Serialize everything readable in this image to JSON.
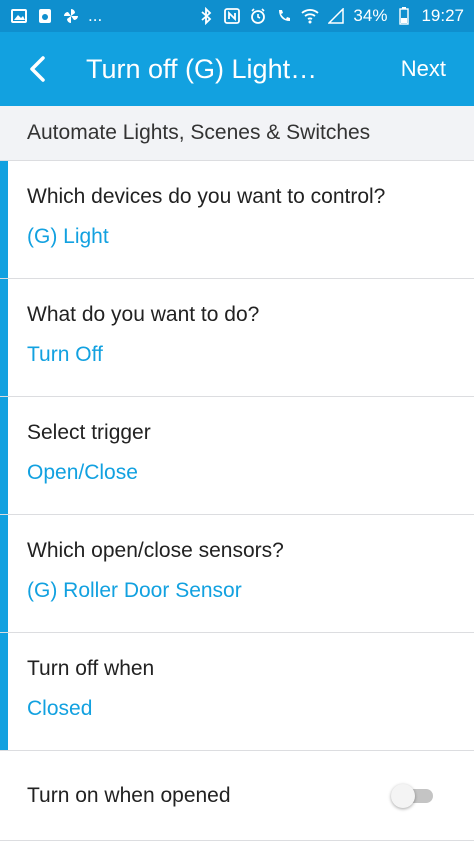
{
  "status_bar": {
    "left_icons": [
      "image-icon",
      "samsung-health-icon",
      "fan-icon"
    ],
    "more": "...",
    "right_icons": [
      "bluetooth-icon",
      "nfc-icon",
      "alarm-icon",
      "wifi-calling-icon",
      "wifi-icon",
      "signal-icon"
    ],
    "battery": "34%",
    "time": "19:27"
  },
  "app_bar": {
    "back_icon": "back-arrow-icon",
    "title": "Turn off (G) Light…",
    "next_label": "Next"
  },
  "subheader": {
    "title": "Automate Lights, Scenes & Switches"
  },
  "rows": [
    {
      "label": "Which devices do you want to control?",
      "value": "(G) Light"
    },
    {
      "label": "What do you want to do?",
      "value": "Turn Off"
    },
    {
      "label": "Select trigger",
      "value": "Open/Close"
    },
    {
      "label": "Which open/close sensors?",
      "value": "(G) Roller Door Sensor"
    },
    {
      "label": "Turn off when",
      "value": "Closed"
    }
  ],
  "toggle_row": {
    "label": "Turn on when opened",
    "enabled": false
  },
  "colors": {
    "status_bar": "#0f8fce",
    "app_bar": "#12a1e0",
    "accent": "#12a1e0",
    "subheader_bg": "#f2f3f6"
  }
}
